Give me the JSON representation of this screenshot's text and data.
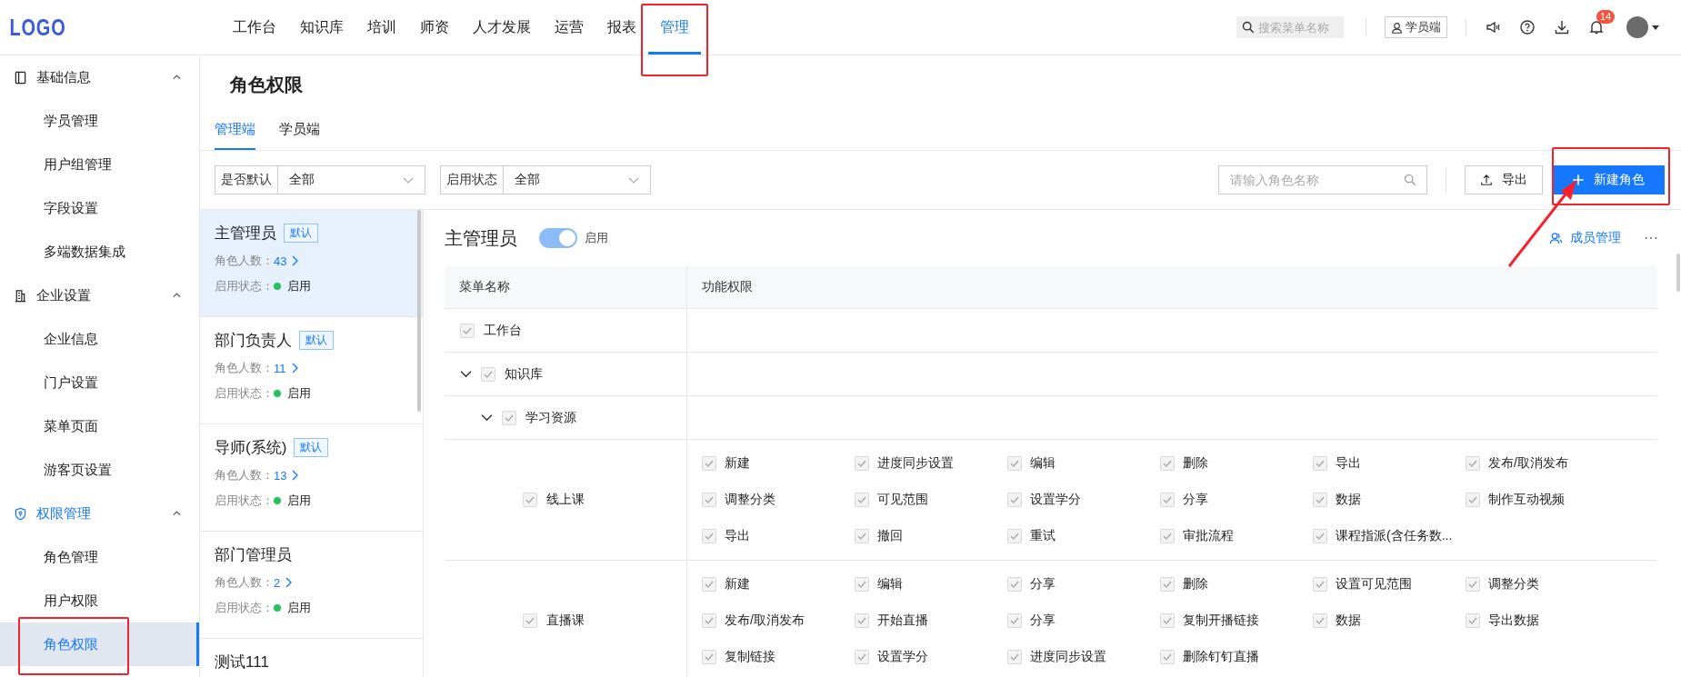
{
  "header": {
    "logo": "LOGO",
    "nav": [
      {
        "label": "工作台",
        "selected": false
      },
      {
        "label": "知识库",
        "selected": false
      },
      {
        "label": "培训",
        "selected": false
      },
      {
        "label": "师资",
        "selected": false
      },
      {
        "label": "人才发展",
        "selected": false
      },
      {
        "label": "运营",
        "selected": false
      },
      {
        "label": "报表",
        "selected": false
      },
      {
        "label": "管理",
        "selected": true
      }
    ],
    "search": {
      "placeholder": "搜索菜单名称"
    },
    "student_button": "学员端",
    "notification_count": "14"
  },
  "sidebar": {
    "groups": [
      {
        "label": "基础信息",
        "expanded": true,
        "children": [
          {
            "label": "学员管理",
            "selected": false
          },
          {
            "label": "用户组管理",
            "selected": false
          },
          {
            "label": "字段设置",
            "selected": false
          },
          {
            "label": "多端数据集成",
            "selected": false
          }
        ]
      },
      {
        "label": "企业设置",
        "expanded": true,
        "children": [
          {
            "label": "企业信息",
            "selected": false
          },
          {
            "label": "门户设置",
            "selected": false
          },
          {
            "label": "菜单页面",
            "selected": false
          },
          {
            "label": "游客页设置",
            "selected": false
          }
        ]
      },
      {
        "label": "权限管理",
        "expanded": true,
        "children": [
          {
            "label": "角色管理",
            "selected": false
          },
          {
            "label": "用户权限",
            "selected": false
          },
          {
            "label": "角色权限",
            "selected": true
          }
        ]
      }
    ]
  },
  "page": {
    "title": "角色权限",
    "tabs": [
      {
        "label": "管理端",
        "selected": true
      },
      {
        "label": "学员端",
        "selected": false
      }
    ],
    "filters": [
      {
        "label": "是否默认",
        "value": "全部"
      },
      {
        "label": "启用状态",
        "value": "全部"
      }
    ],
    "role_search": {
      "placeholder": "请输入角色名称"
    },
    "export_button": "导出",
    "new_button": "新建角色"
  },
  "roles": [
    {
      "name": "主管理员",
      "tag": "默认",
      "count_label": "角色人数：",
      "count": "43",
      "status_label": "启用状态：",
      "status": "启用",
      "enabled": true,
      "selected": true
    },
    {
      "name": "部门负责人",
      "tag": "默认",
      "count_label": "角色人数：",
      "count": "11",
      "status_label": "启用状态：",
      "status": "启用",
      "enabled": true,
      "selected": false
    },
    {
      "name": "导师(系统)",
      "tag": "默认",
      "count_label": "角色人数：",
      "count": "13",
      "status_label": "启用状态：",
      "status": "启用",
      "enabled": true,
      "selected": false
    },
    {
      "name": "部门管理员",
      "count_label": "角色人数：",
      "count": "2",
      "status_label": "启用状态：",
      "status": "启用",
      "enabled": true,
      "selected": false
    },
    {
      "name": "测试111",
      "selected": false
    }
  ],
  "detail": {
    "title": "主管理员",
    "toggle": {
      "on": true,
      "label": "启用"
    },
    "member_button": "成员管理",
    "table": {
      "columns": [
        "菜单名称",
        "功能权限"
      ],
      "rows": [
        {
          "label": "工作台",
          "checked": true
        },
        {
          "label": "知识库",
          "checked": true,
          "expanded": true,
          "children": [
            {
              "label": "学习资源",
              "checked": true,
              "expanded": true,
              "children": [
                {
                  "label": "线上课",
                  "checked": true,
                  "permissions": [
                    {
                      "label": "新建",
                      "checked": true
                    },
                    {
                      "label": "进度同步设置",
                      "checked": true
                    },
                    {
                      "label": "编辑",
                      "checked": true
                    },
                    {
                      "label": "删除",
                      "checked": true
                    },
                    {
                      "label": "导出",
                      "checked": true
                    },
                    {
                      "label": "发布/取消发布",
                      "checked": true
                    },
                    {
                      "label": "调整分类",
                      "checked": true
                    },
                    {
                      "label": "可见范围",
                      "checked": true
                    },
                    {
                      "label": "设置学分",
                      "checked": true
                    },
                    {
                      "label": "分享",
                      "checked": true
                    },
                    {
                      "label": "数据",
                      "checked": true
                    },
                    {
                      "label": "制作互动视频",
                      "checked": true
                    },
                    {
                      "label": "导出",
                      "checked": true
                    },
                    {
                      "label": "撤回",
                      "checked": true
                    },
                    {
                      "label": "重试",
                      "checked": true
                    },
                    {
                      "label": "审批流程",
                      "checked": true
                    },
                    {
                      "label": "课程指派(含任务数...",
                      "checked": true
                    }
                  ]
                },
                {
                  "label": "直播课",
                  "checked": true,
                  "permissions": [
                    {
                      "label": "新建",
                      "checked": true
                    },
                    {
                      "label": "编辑",
                      "checked": true
                    },
                    {
                      "label": "分享",
                      "checked": true
                    },
                    {
                      "label": "删除",
                      "checked": true
                    },
                    {
                      "label": "设置可见范围",
                      "checked": true
                    },
                    {
                      "label": "调整分类",
                      "checked": true
                    },
                    {
                      "label": "发布/取消发布",
                      "checked": true
                    },
                    {
                      "label": "开始直播",
                      "checked": true
                    },
                    {
                      "label": "分享",
                      "checked": true
                    },
                    {
                      "label": "复制开播链接",
                      "checked": true
                    },
                    {
                      "label": "数据",
                      "checked": true
                    },
                    {
                      "label": "导出数据",
                      "checked": true
                    },
                    {
                      "label": "复制链接",
                      "checked": true
                    },
                    {
                      "label": "设置学分",
                      "checked": true
                    },
                    {
                      "label": "进度同步设置",
                      "checked": true
                    },
                    {
                      "label": "删除钉钉直播",
                      "checked": true
                    }
                  ]
                }
              ]
            }
          ]
        }
      ]
    }
  }
}
